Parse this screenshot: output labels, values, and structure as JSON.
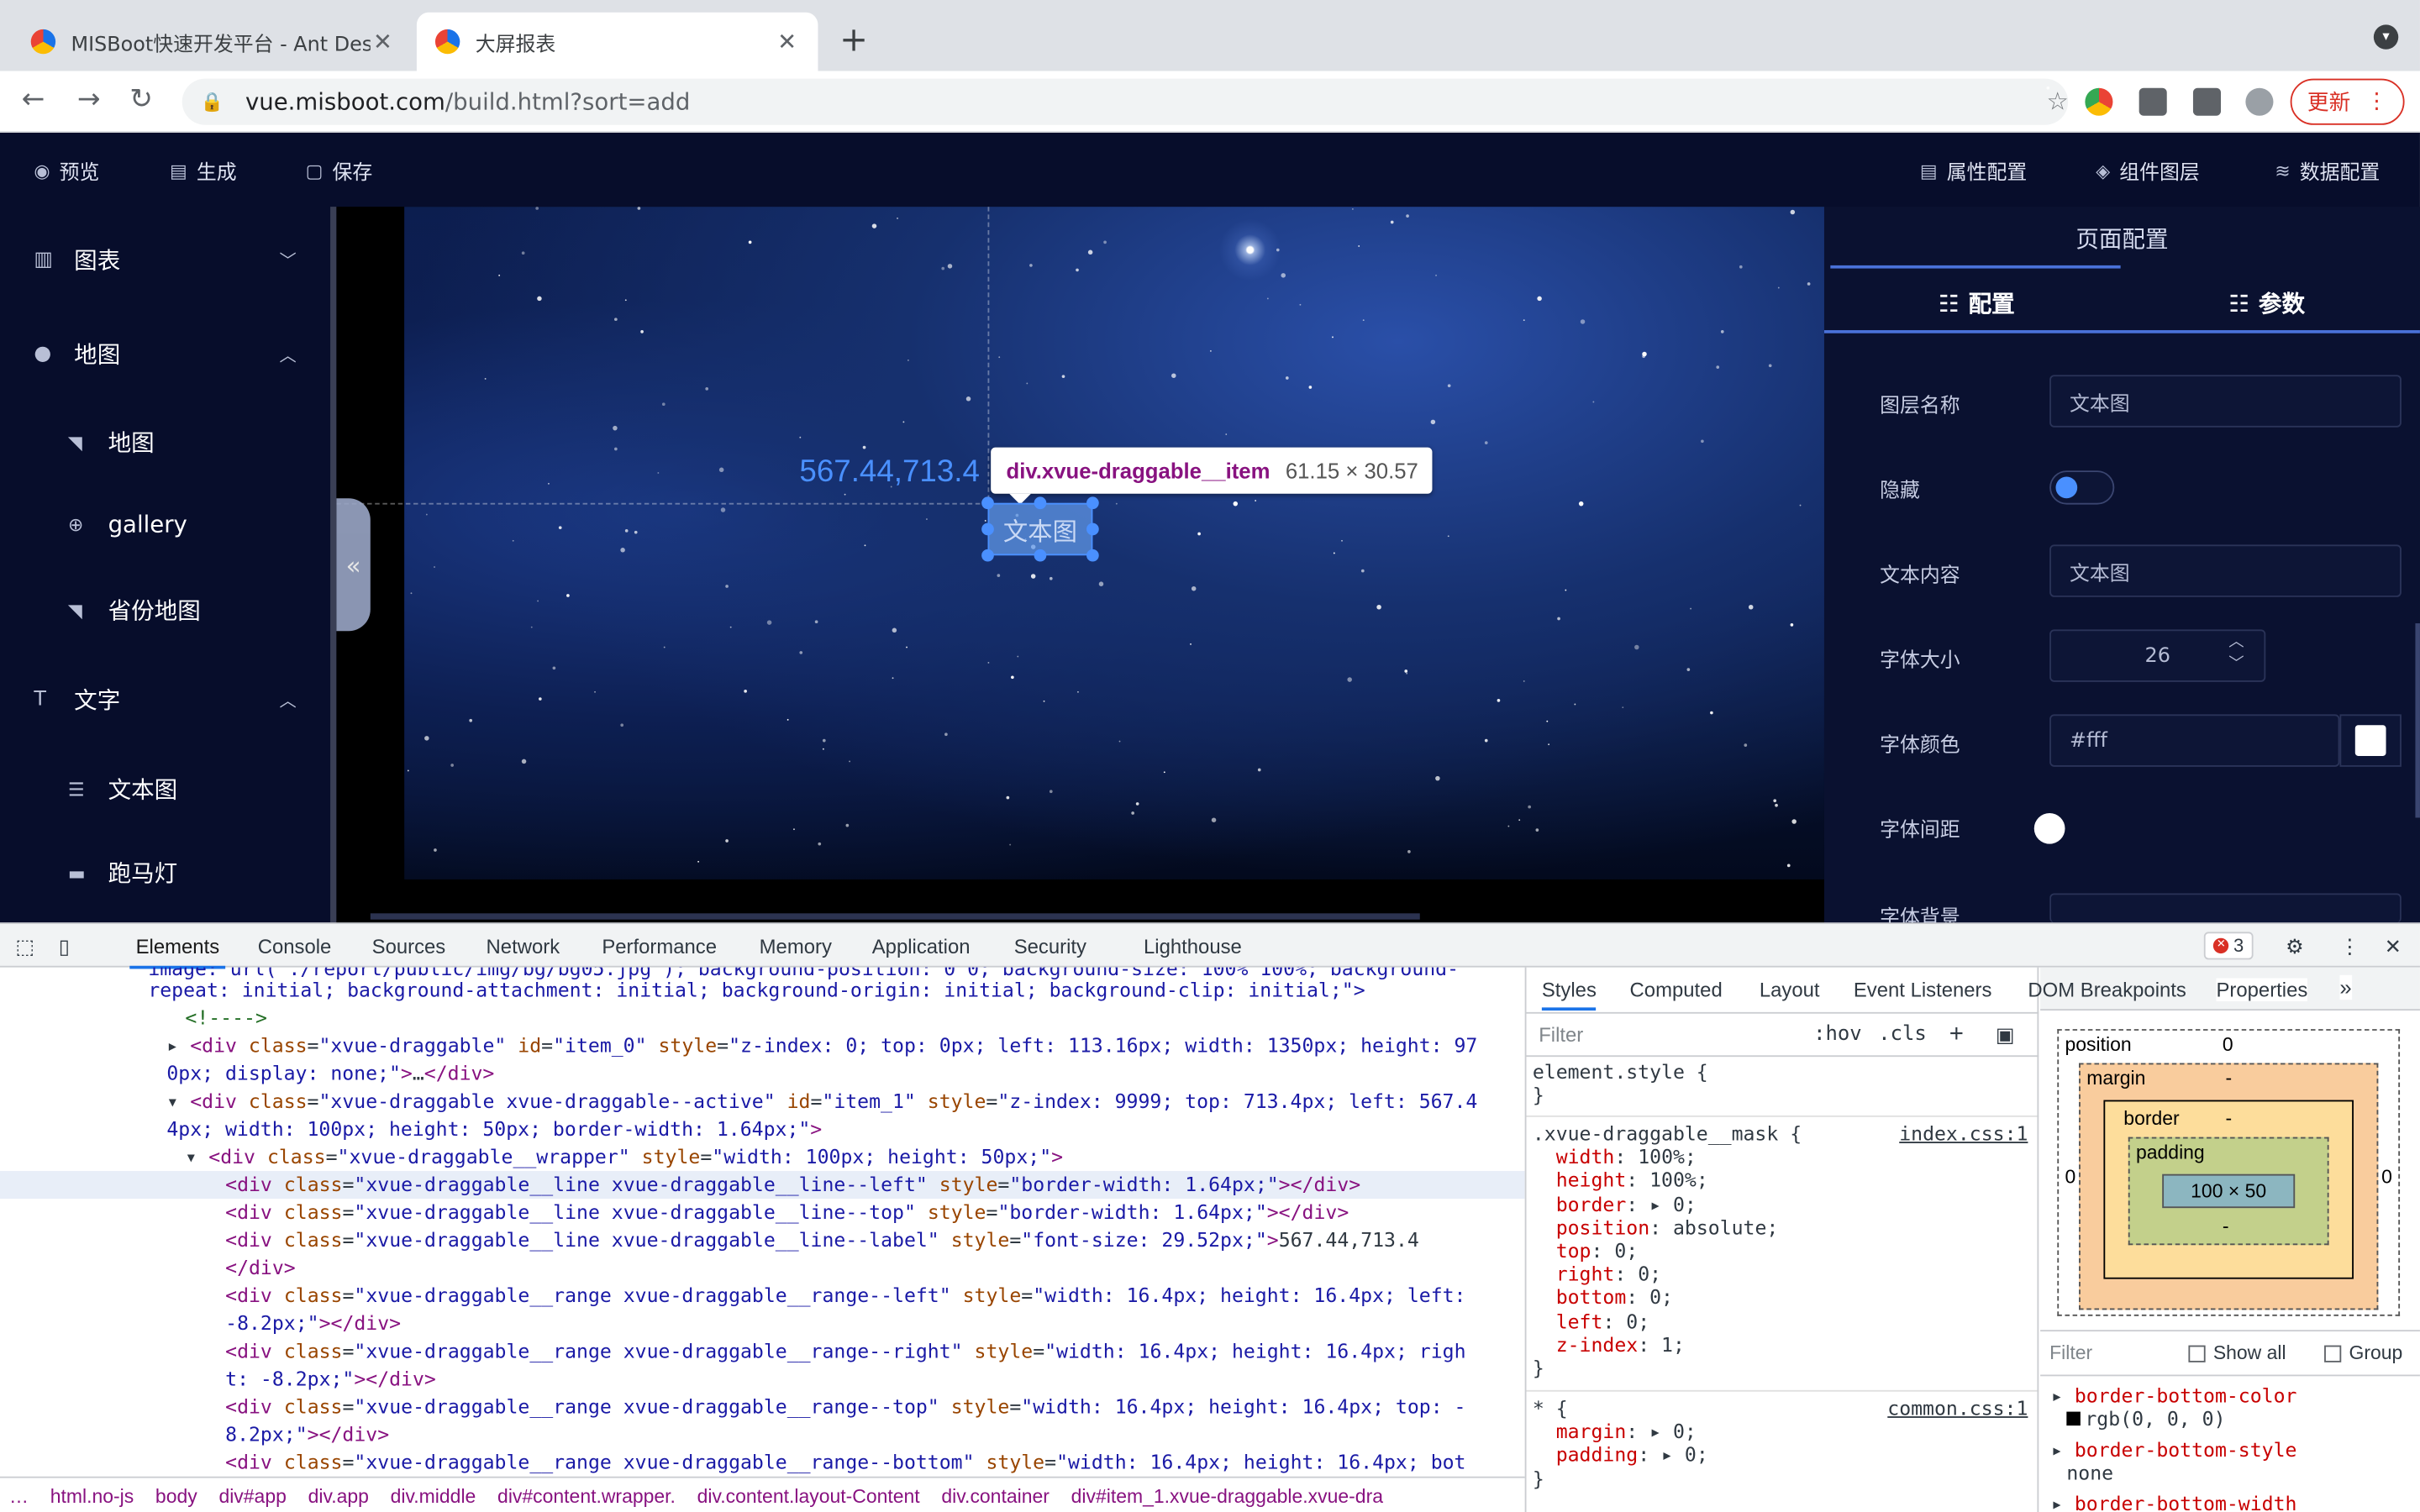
{
  "browser": {
    "tabs": [
      {
        "title": "MISBoot快速开发平台 - Ant Design"
      },
      {
        "title": "大屏报表"
      }
    ],
    "url_domain": "vue.misboot.com",
    "url_path": "/build.html?sort=add",
    "update_label": "更新"
  },
  "app": {
    "toolbar": {
      "preview": "预览",
      "generate": "生成",
      "save": "保存",
      "attr_config": "属性配置",
      "layer": "组件图层",
      "data_config": "数据配置"
    },
    "sidebar": {
      "groups": [
        {
          "label": "图表"
        },
        {
          "label": "地图",
          "items": [
            "地图",
            "gallery",
            "省份地图"
          ]
        },
        {
          "label": "文字",
          "items": [
            "文本图",
            "跑马灯"
          ]
        }
      ]
    },
    "canvas": {
      "coord_label": "567.44,713.4",
      "item_text": "文本图",
      "tooltip_selector": "div.xvue-draggable__item",
      "tooltip_size": "61.15 × 30.57"
    },
    "right_panel": {
      "title": "页面配置",
      "tab_config": "配置",
      "tab_params": "参数",
      "fields": {
        "layer_name_label": "图层名称",
        "layer_name_value": "文本图",
        "hidden_label": "隐藏",
        "text_label": "文本内容",
        "text_value": "文本图",
        "font_size_label": "字体大小",
        "font_size_value": "26",
        "font_color_label": "字体颜色",
        "font_color_value": "#fff",
        "letter_spacing_label": "字体间距",
        "font_bg_label": "字体背景"
      }
    }
  },
  "devtools": {
    "tabs": [
      "Elements",
      "Console",
      "Sources",
      "Network",
      "Performance",
      "Memory",
      "Application",
      "Security",
      "Lighthouse"
    ],
    "error_count": "3",
    "styles_tabs": [
      "Styles",
      "Computed",
      "Layout",
      "Event Listeners",
      "DOM Breakpoints",
      "Properties"
    ],
    "filter_placeholder": "Filter",
    "hov": ":hov",
    "cls": ".cls",
    "breadcrumbs": [
      "html.no-js",
      "body",
      "div#app",
      "div.app",
      "div.middle",
      "div#content.wrapper.",
      "div.content.layout-Content",
      "div.container",
      "div#item_1.xvue-draggable.xvue-dra"
    ],
    "box_model": {
      "position": "position",
      "position_val": "0",
      "margin": "margin",
      "border": "border",
      "padding": "padding",
      "content": "100 × 50",
      "dash": "-",
      "zero": "0"
    },
    "computed_filter": "Filter",
    "show_all": "Show all",
    "group": "Group",
    "computed": [
      {
        "prop": "border-bottom-color",
        "val": "rgb(0, 0, 0)"
      },
      {
        "prop": "border-bottom-style",
        "val": "none"
      },
      {
        "prop": "border-bottom-width",
        "val": ""
      }
    ],
    "rules": {
      "element_style": "element.style {",
      "mask_selector": ".xvue-draggable__mask {",
      "mask_source": "index.css:1",
      "universal_selector": "* {",
      "universal_source": "common.css:1"
    }
  }
}
